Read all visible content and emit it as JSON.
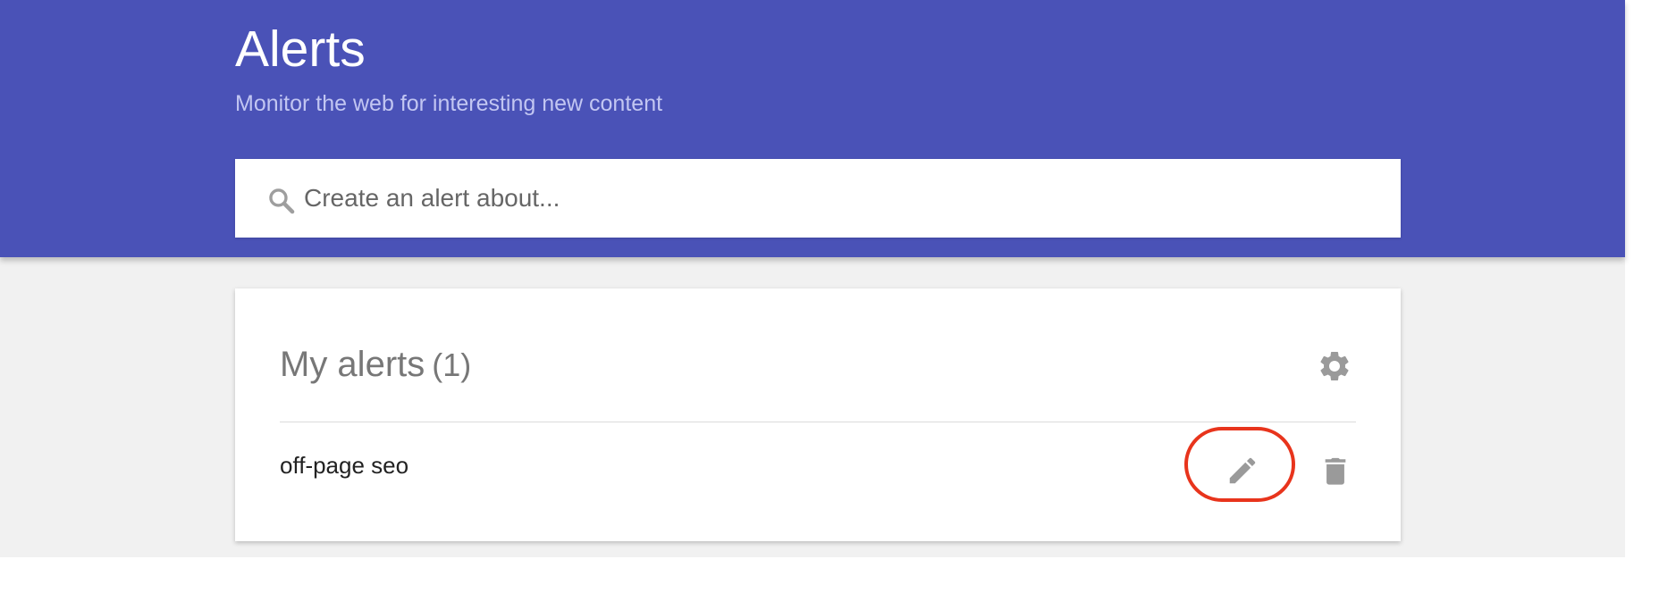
{
  "header": {
    "title": "Alerts",
    "subtitle": "Monitor the web for interesting new content",
    "background_color": "#4a52b7"
  },
  "search": {
    "placeholder": "Create an alert about...",
    "value": "",
    "icon": "search-icon"
  },
  "my_alerts": {
    "heading": "My alerts",
    "count": "(1)",
    "settings_icon": "gear-icon",
    "alerts": [
      {
        "name": "off-page seo",
        "edit_icon": "pencil-icon",
        "delete_icon": "trash-icon"
      }
    ]
  },
  "annotation": {
    "highlight_color": "#e8341c",
    "highlight_target": "edit-alert-button"
  }
}
